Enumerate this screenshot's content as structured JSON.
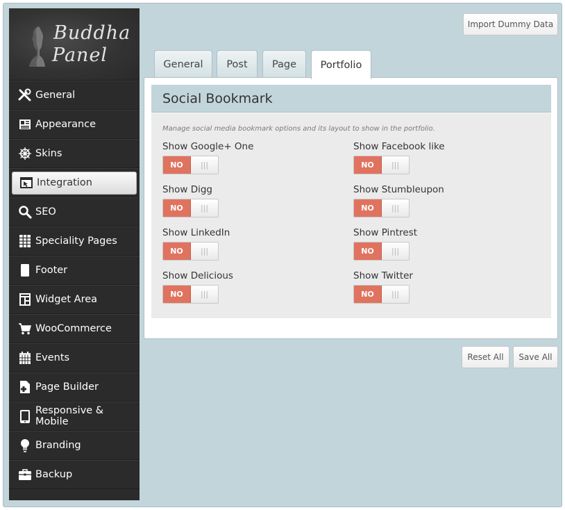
{
  "logo": {
    "line1": "Buddha",
    "line2": "Panel"
  },
  "sidebar": {
    "items": [
      {
        "label": "General",
        "icon": "wrench-screwdriver-icon"
      },
      {
        "label": "Appearance",
        "icon": "appearance-icon"
      },
      {
        "label": "Skins",
        "icon": "ship-wheel-icon"
      },
      {
        "label": "Integration",
        "icon": "window-cursor-icon",
        "active": true
      },
      {
        "label": "SEO",
        "icon": "search-icon"
      },
      {
        "label": "Speciality Pages",
        "icon": "grid-icon"
      },
      {
        "label": "Footer",
        "icon": "footer-icon"
      },
      {
        "label": "Widget Area",
        "icon": "widget-icon"
      },
      {
        "label": "WooCommerce",
        "icon": "cart-icon"
      },
      {
        "label": "Events",
        "icon": "calendar-icon"
      },
      {
        "label": "Page Builder",
        "icon": "page-builder-icon"
      },
      {
        "label": "Responsive & Mobile",
        "icon": "mobile-icon"
      },
      {
        "label": "Branding",
        "icon": "lightbulb-icon"
      },
      {
        "label": "Backup",
        "icon": "briefcase-icon"
      }
    ]
  },
  "header": {
    "import_label": "Import Dummy Data"
  },
  "tabs": [
    {
      "label": "General"
    },
    {
      "label": "Post"
    },
    {
      "label": "Page"
    },
    {
      "label": "Portfolio",
      "active": true
    }
  ],
  "section": {
    "title": "Social Bookmark",
    "description": "Manage social media bookmark options and its layout to show in the portfolio.",
    "options": [
      {
        "label": "Show Google+ One",
        "value": "NO"
      },
      {
        "label": "Show Facebook like",
        "value": "NO"
      },
      {
        "label": "Show Digg",
        "value": "NO"
      },
      {
        "label": "Show Stumbleupon",
        "value": "NO"
      },
      {
        "label": "Show LinkedIn",
        "value": "NO"
      },
      {
        "label": "Show Pintrest",
        "value": "NO"
      },
      {
        "label": "Show Delicious",
        "value": "NO"
      },
      {
        "label": "Show Twitter",
        "value": "NO"
      }
    ],
    "toggle_grip": "|||"
  },
  "footer": {
    "reset_label": "Reset All",
    "save_label": "Save All"
  },
  "colors": {
    "background": "#c2d5db",
    "sidebar": "#2b2b2b",
    "toggle_off": "#e0735f"
  }
}
